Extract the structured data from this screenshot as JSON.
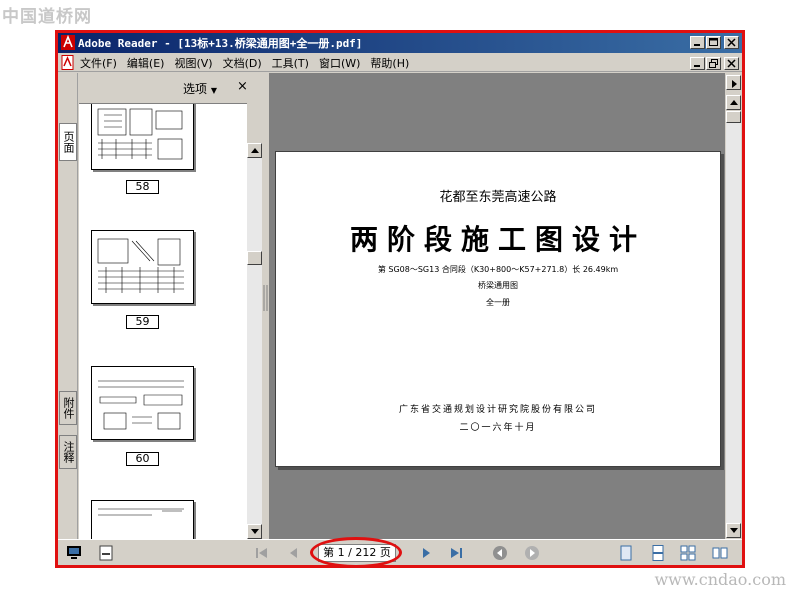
{
  "watermarks": {
    "top": "中国道桥网",
    "bottom": "www.cndao.com"
  },
  "window": {
    "title": "Adobe Reader - [13标+13.桥梁通用图+全一册.pdf]",
    "menu": [
      "文件(F)",
      "编辑(E)",
      "视图(V)",
      "文档(D)",
      "工具(T)",
      "窗口(W)",
      "帮助(H)"
    ]
  },
  "nav_tabs": {
    "pages": "页面",
    "attachments": "附件",
    "comments": "注释"
  },
  "thumbnails": {
    "options_label": "选项",
    "close_label": "×",
    "pages": [
      "58",
      "59",
      "60"
    ]
  },
  "document": {
    "project": "花都至东莞高速公路",
    "heading": "两阶段施工图设计",
    "section": "第 SG08～SG13 合同段（K30+800～K57+271.8）长 26.49km",
    "volume": "桥梁通用图",
    "book": "全一册",
    "institute": "广东省交通规划设计研究院股份有限公司",
    "date": "二〇一六年十月"
  },
  "status": {
    "page_indicator": "第 1 / 212 页"
  },
  "colors": {
    "titlebar": "#0a246a",
    "highlight": "#e01010",
    "doc_bg": "#808080"
  }
}
